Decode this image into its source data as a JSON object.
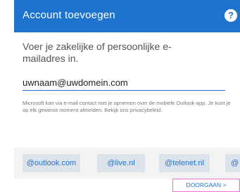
{
  "header": {
    "title": "Account toevoegen",
    "help_glyph": "?"
  },
  "prompt": "Voer je zakelijke of persoonlijke e-mailadres in.",
  "email": {
    "value": "uwnaam@uwdomein.com"
  },
  "notice": "Microsoft kan via e-mail contact met je opnemen over de mobiele Outlook-app. Je kunt je op elk gewenst moment afmelden. Bekijk ons privacybeleid.",
  "domains": [
    "@outlook.com",
    "@live.nl",
    "@telenet.nl",
    "@"
  ],
  "footer": {
    "continue_label": "DOORGAAN >"
  },
  "colors": {
    "accent": "#1e73cf",
    "highlight_border": "#f070dc"
  }
}
